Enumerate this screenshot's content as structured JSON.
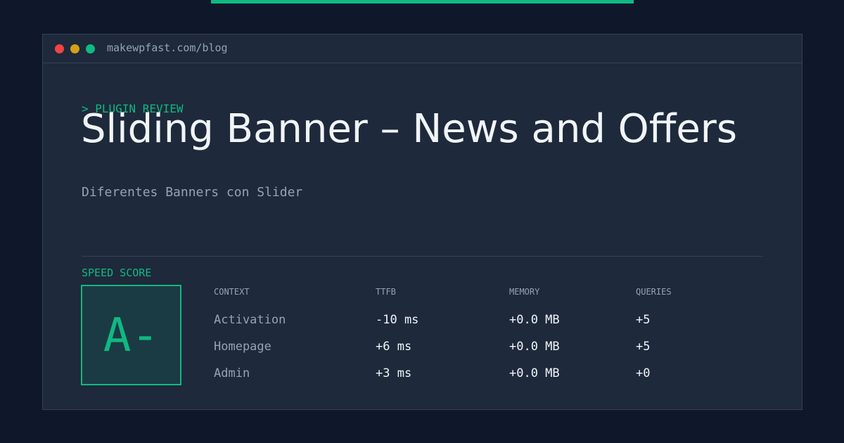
{
  "colors": {
    "background": "#0f172a",
    "window": "#1e293b",
    "border": "#334155",
    "accent": "#10b981",
    "text_primary": "#f1f5f9",
    "text_muted": "#94a3b8",
    "dot_red": "#ef4444",
    "dot_yellow": "#d4a017",
    "dot_green": "#10b981"
  },
  "window": {
    "url": "makewpfast.com/blog",
    "controls": [
      "close-dot",
      "minimize-dot",
      "maximize-dot"
    ]
  },
  "article": {
    "eyebrow": "> PLUGIN REVIEW",
    "title": "Sliding Banner – News and Offers",
    "subtitle": "Diferentes Banners con Slider"
  },
  "speed": {
    "label": "SPEED SCORE",
    "grade": "A-"
  },
  "metrics": {
    "headers": {
      "context": "CONTEXT",
      "ttfb": "TTFB",
      "memory": "MEMORY",
      "queries": "QUERIES"
    },
    "rows": [
      {
        "context": "Activation",
        "ttfb": "-10 ms",
        "memory": "+0.0 MB",
        "queries": "+5"
      },
      {
        "context": "Homepage",
        "ttfb": "+6 ms",
        "memory": "+0.0 MB",
        "queries": "+5"
      },
      {
        "context": "Admin",
        "ttfb": "+3 ms",
        "memory": "+0.0 MB",
        "queries": "+0"
      }
    ]
  }
}
